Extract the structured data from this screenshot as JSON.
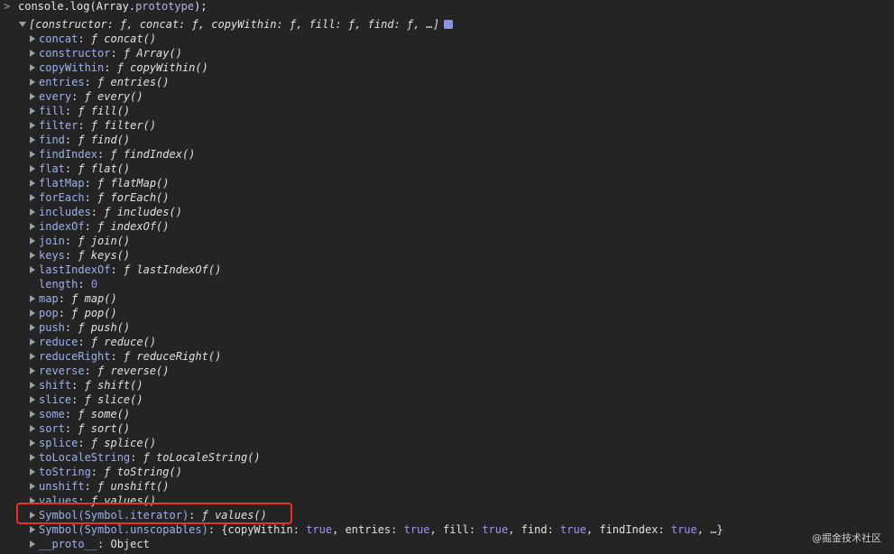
{
  "input": {
    "prompt": ">",
    "text_prefix": "console.",
    "text_log": "log",
    "text_mid": "(Array.",
    "text_prop": "prototype",
    "text_suffix": ");"
  },
  "summary": {
    "text": "[constructor: ƒ, concat: ƒ, copyWithin: ƒ, fill: ƒ, find: ƒ, …]"
  },
  "rows": [
    {
      "key": "concat",
      "val": "ƒ concat()",
      "kind": "fn",
      "expandable": true
    },
    {
      "key": "constructor",
      "val": "ƒ Array()",
      "kind": "fn",
      "expandable": true
    },
    {
      "key": "copyWithin",
      "val": "ƒ copyWithin()",
      "kind": "fn",
      "expandable": true
    },
    {
      "key": "entries",
      "val": "ƒ entries()",
      "kind": "fn",
      "expandable": true
    },
    {
      "key": "every",
      "val": "ƒ every()",
      "kind": "fn",
      "expandable": true
    },
    {
      "key": "fill",
      "val": "ƒ fill()",
      "kind": "fn",
      "expandable": true
    },
    {
      "key": "filter",
      "val": "ƒ filter()",
      "kind": "fn",
      "expandable": true
    },
    {
      "key": "find",
      "val": "ƒ find()",
      "kind": "fn",
      "expandable": true
    },
    {
      "key": "findIndex",
      "val": "ƒ findIndex()",
      "kind": "fn",
      "expandable": true
    },
    {
      "key": "flat",
      "val": "ƒ flat()",
      "kind": "fn",
      "expandable": true
    },
    {
      "key": "flatMap",
      "val": "ƒ flatMap()",
      "kind": "fn",
      "expandable": true
    },
    {
      "key": "forEach",
      "val": "ƒ forEach()",
      "kind": "fn",
      "expandable": true
    },
    {
      "key": "includes",
      "val": "ƒ includes()",
      "kind": "fn",
      "expandable": true
    },
    {
      "key": "indexOf",
      "val": "ƒ indexOf()",
      "kind": "fn",
      "expandable": true
    },
    {
      "key": "join",
      "val": "ƒ join()",
      "kind": "fn",
      "expandable": true
    },
    {
      "key": "keys",
      "val": "ƒ keys()",
      "kind": "fn",
      "expandable": true
    },
    {
      "key": "lastIndexOf",
      "val": "ƒ lastIndexOf()",
      "kind": "fn",
      "expandable": true
    },
    {
      "key": "length",
      "val": "0",
      "kind": "num",
      "expandable": false
    },
    {
      "key": "map",
      "val": "ƒ map()",
      "kind": "fn",
      "expandable": true
    },
    {
      "key": "pop",
      "val": "ƒ pop()",
      "kind": "fn",
      "expandable": true
    },
    {
      "key": "push",
      "val": "ƒ push()",
      "kind": "fn",
      "expandable": true
    },
    {
      "key": "reduce",
      "val": "ƒ reduce()",
      "kind": "fn",
      "expandable": true
    },
    {
      "key": "reduceRight",
      "val": "ƒ reduceRight()",
      "kind": "fn",
      "expandable": true
    },
    {
      "key": "reverse",
      "val": "ƒ reverse()",
      "kind": "fn",
      "expandable": true
    },
    {
      "key": "shift",
      "val": "ƒ shift()",
      "kind": "fn",
      "expandable": true
    },
    {
      "key": "slice",
      "val": "ƒ slice()",
      "kind": "fn",
      "expandable": true
    },
    {
      "key": "some",
      "val": "ƒ some()",
      "kind": "fn",
      "expandable": true
    },
    {
      "key": "sort",
      "val": "ƒ sort()",
      "kind": "fn",
      "expandable": true
    },
    {
      "key": "splice",
      "val": "ƒ splice()",
      "kind": "fn",
      "expandable": true
    },
    {
      "key": "toLocaleString",
      "val": "ƒ toLocaleString()",
      "kind": "fn",
      "expandable": true
    },
    {
      "key": "toString",
      "val": "ƒ toString()",
      "kind": "fn",
      "expandable": true
    },
    {
      "key": "unshift",
      "val": "ƒ unshift()",
      "kind": "fn",
      "expandable": true
    },
    {
      "key": "values",
      "val": "ƒ values()",
      "kind": "fn",
      "expandable": true
    },
    {
      "key": "Symbol(Symbol.iterator)",
      "val": "ƒ values()",
      "kind": "fn",
      "expandable": true,
      "highlighted": true
    },
    {
      "key": "Symbol(Symbol.unscopables)",
      "kind": "obj",
      "expandable": true,
      "obj_parts": [
        {
          "t": "{copyWithin: ",
          "c": "plain"
        },
        {
          "t": "true",
          "c": "bool"
        },
        {
          "t": ", entries: ",
          "c": "plain"
        },
        {
          "t": "true",
          "c": "bool"
        },
        {
          "t": ", fill: ",
          "c": "plain"
        },
        {
          "t": "true",
          "c": "bool"
        },
        {
          "t": ", find: ",
          "c": "plain"
        },
        {
          "t": "true",
          "c": "bool"
        },
        {
          "t": ", findIndex: ",
          "c": "plain"
        },
        {
          "t": "true",
          "c": "bool"
        },
        {
          "t": ", …}",
          "c": "plain"
        }
      ]
    },
    {
      "key": "__proto__",
      "val": "Object",
      "kind": "plain",
      "expandable": true
    }
  ],
  "watermark": "@掘金技术社区",
  "colors": {
    "background": "#242424",
    "key": "#9db1e8",
    "value": "#e0e0e0",
    "number": "#9d95f5",
    "highlight_border": "#e5332a",
    "info_badge": "#8b93e8"
  },
  "icons": {
    "prompt": "chevron-right-icon",
    "expand_open": "triangle-down-icon",
    "expand_closed": "triangle-right-icon",
    "info": "info-badge-icon"
  }
}
